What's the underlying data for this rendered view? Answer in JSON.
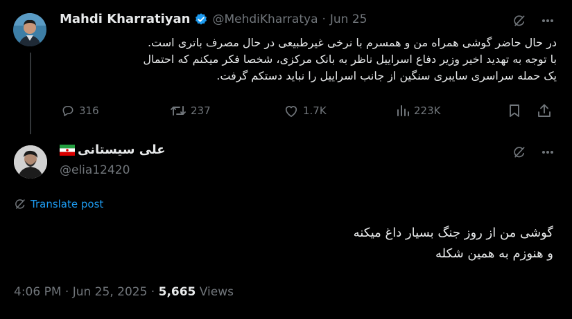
{
  "parent": {
    "name": "Mahdi Kharratiyan",
    "handle": "@MehdiKharratya",
    "separator": "·",
    "date": "Jun 25",
    "lines": [
      "در حال حاضر گوشی همراه من و همسرم با نرخی غیرطبیعی در حال مصرف باتری است.",
      "با توجه به تهدید اخیر وزیر دفاع اسراییل ناظر به بانک مرکزی، شخصا فکر میکنم که احتمال",
      "یک حمله سراسری سایبری سنگین از جانب اسراییل را نباید دستکم گرفت."
    ],
    "actions": {
      "replies": "316",
      "reposts": "237",
      "likes": "1.7K",
      "views": "223K"
    }
  },
  "reply": {
    "name": "علی سیستانی",
    "handle": "@elia12420",
    "translate_label": "Translate post",
    "lines": [
      "گوشی من از روز جنگ بسیار داغ میکنه",
      "و هنوزم به همین شکله"
    ],
    "time": "4:06 PM",
    "date": "Jun 25, 2025",
    "views_count": "5,665",
    "views_label": "Views",
    "dot": "·"
  },
  "colors": {
    "background": "#000000",
    "text": "#e7e9ea",
    "muted": "#71767b",
    "accent": "#1d9bf0",
    "divider": "#333639"
  }
}
